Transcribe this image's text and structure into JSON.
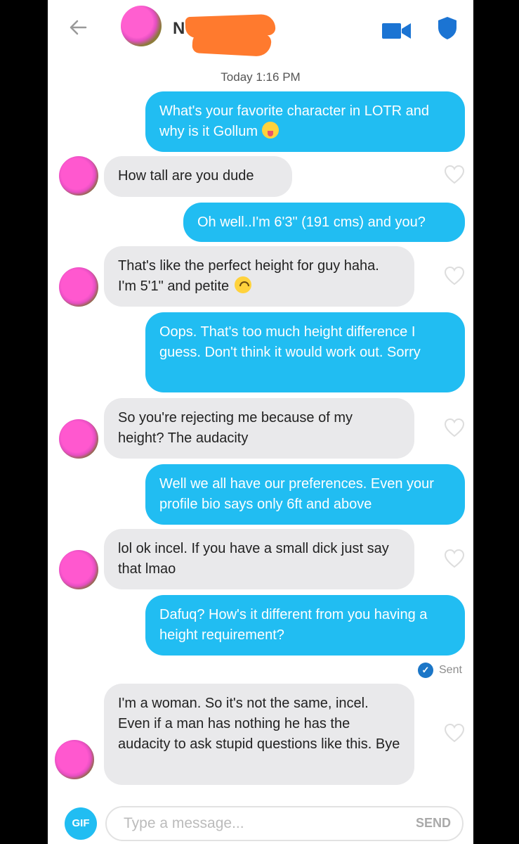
{
  "header": {
    "name_visible": "N",
    "back_icon": "back-arrow-icon",
    "video_icon": "video-camera-icon",
    "safety_icon": "shield-icon"
  },
  "timestamp": "Today 1:16 PM",
  "messages": [
    {
      "sender": "me",
      "text": "What's your favorite character in LOTR and why is it Gollum",
      "emoji": "tongue-out-emoji"
    },
    {
      "sender": "them",
      "text": "How tall are you dude"
    },
    {
      "sender": "me",
      "text": "Oh well..I'm 6'3\" (191 cms) and you?"
    },
    {
      "sender": "them",
      "text": "That's like the perfect height for guy haha. I'm 5'1\" and petite",
      "emoji": "upside-down-smile-emoji"
    },
    {
      "sender": "me",
      "text": "Oops. That's too much height difference I guess. Don't think it would work out. Sorry"
    },
    {
      "sender": "them",
      "text": "So you're rejecting me because of my height? The audacity"
    },
    {
      "sender": "me",
      "text": "Well we all have our preferences. Even your profile bio says only 6ft and above"
    },
    {
      "sender": "them",
      "text": "lol ok incel. If you have a small dick just say that lmao"
    },
    {
      "sender": "me",
      "text": "Dafuq? How's it different from you having a height requirement?"
    },
    {
      "sender": "them",
      "text": "I'm a woman. So it's not the same, incel. Even if a man has nothing he has the audacity to ask stupid questions like this. Bye"
    }
  ],
  "status": {
    "sent_label": "Sent"
  },
  "composer": {
    "gif_label": "GIF",
    "placeholder": "Type a message...",
    "send_label": "SEND"
  },
  "colors": {
    "outgoing": "#21bdf2",
    "incoming": "#e9e9eb",
    "sent_badge": "#1b76c7"
  }
}
